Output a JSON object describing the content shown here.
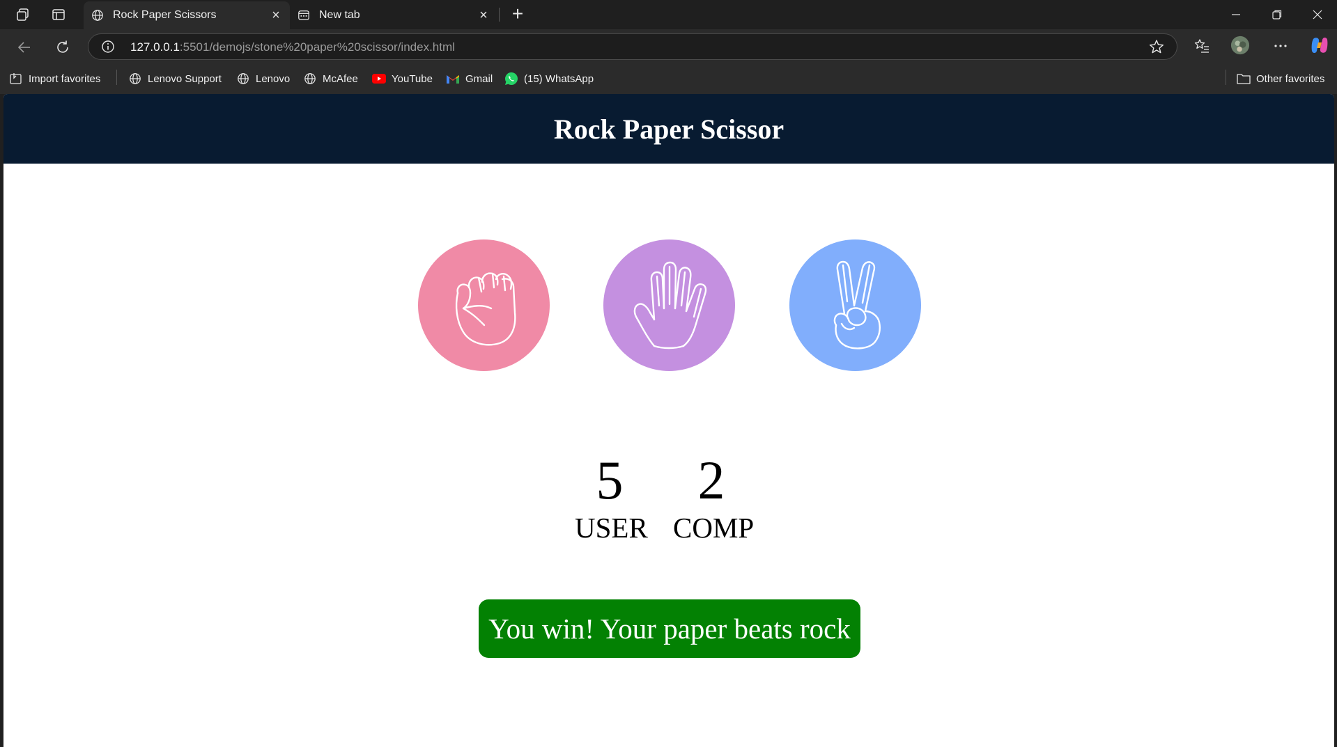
{
  "browser": {
    "tabs": [
      {
        "title": "Rock Paper Scissors",
        "active": true
      },
      {
        "title": "New tab",
        "active": false
      }
    ],
    "url": {
      "host": "127.0.0.1",
      "rest": ":5501/demojs/stone%20paper%20scissor/index.html"
    },
    "bookmarks": [
      {
        "label": "Import favorites"
      },
      {
        "label": "Lenovo Support"
      },
      {
        "label": "Lenovo"
      },
      {
        "label": "McAfee"
      },
      {
        "label": "YouTube"
      },
      {
        "label": "Gmail"
      },
      {
        "label": "(15) WhatsApp"
      }
    ],
    "other_favorites": "Other favorites"
  },
  "page": {
    "title": "Rock Paper Scissor",
    "header_color": "#081b31",
    "choices": [
      {
        "name": "rock",
        "icon": "fist-icon",
        "color": "#f08aa6"
      },
      {
        "name": "paper",
        "icon": "open-hand-icon",
        "color": "#c490e0"
      },
      {
        "name": "scissors",
        "icon": "peace-hand-icon",
        "color": "#81aefc"
      }
    ],
    "score": {
      "user": "5",
      "user_label": "USER",
      "comp": "2",
      "comp_label": "COMP"
    },
    "message": "You win! Your paper beats rock",
    "message_color": "#038103"
  }
}
